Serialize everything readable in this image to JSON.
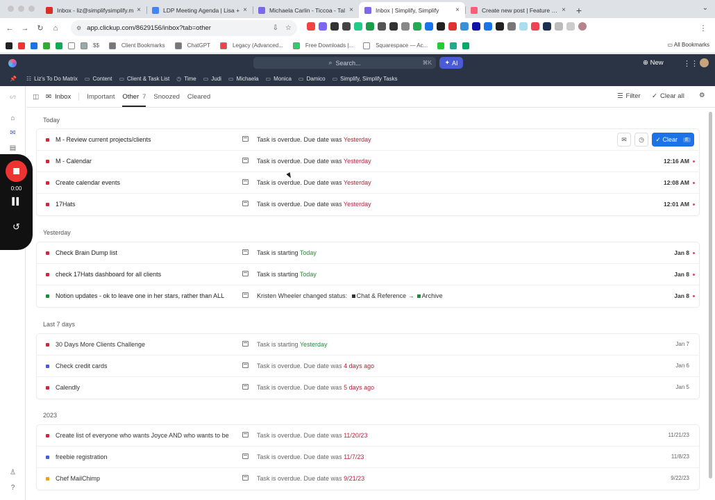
{
  "browser": {
    "tabs": [
      {
        "title": "Inbox - liz@simplifysimplify.m",
        "color": "#d93025",
        "active": false
      },
      {
        "title": "LDP Meeting Agenda | Lisa +",
        "color": "#4285f4",
        "active": false
      },
      {
        "title": "Michaela Carlin - Ticcoa - Tal",
        "color": "#7b68ee",
        "active": false
      },
      {
        "title": "Inbox | Simplify, Simplify",
        "color": "#7b68ee",
        "active": true
      },
      {
        "title": "Create new post | Feature Re",
        "color": "#ff5c7a",
        "active": false
      }
    ],
    "url": "app.clickup.com/8629156/inbox?tab=other",
    "bookmarks": [
      {
        "label": "$$",
        "color": "#9aa"
      },
      {
        "label": "Client Bookmarks",
        "color": "#777"
      },
      {
        "label": "ChatGPT",
        "color": "#777"
      },
      {
        "label": "Legacy (Advanced...",
        "color": "#e44"
      },
      {
        "label": "Free Downloads |...",
        "color": "#3c6"
      },
      {
        "label": "Squarespace — Ac...",
        "color": "#fff"
      }
    ],
    "all_bookmarks": "All Bookmarks"
  },
  "app": {
    "search_placeholder": "Search...",
    "search_shortcut": "⌘K",
    "ai_label": "AI",
    "new_label": "New",
    "favorites": [
      "Liz's To Do Matrix",
      "Content",
      "Client & Task List",
      "Time",
      "Judi",
      "Michaela",
      "Monica",
      "Damico",
      "Simplify, Simplify Tasks"
    ]
  },
  "recorder": {
    "time": "0:00"
  },
  "toolbar": {
    "inbox": "Inbox",
    "tabs": [
      {
        "label": "Important",
        "count": ""
      },
      {
        "label": "Other",
        "count": "7"
      },
      {
        "label": "Snoozed",
        "count": ""
      },
      {
        "label": "Cleared",
        "count": ""
      }
    ],
    "filter": "Filter",
    "clear_all": "Clear all"
  },
  "hover_actions": {
    "clear": "Clear",
    "clear_key": "E"
  },
  "sections": [
    {
      "title": "Today",
      "rows": [
        {
          "name": "M - Review current projects/clients",
          "pri": "#c62b3e",
          "msg": "Task is overdue. Due date was ",
          "hl": "Yesterday",
          "hl_type": "red",
          "date": "",
          "hover": true
        },
        {
          "name": "M - Calendar",
          "pri": "#c62b3e",
          "msg": "Task is overdue. Due date was ",
          "hl": "Yesterday",
          "hl_type": "red",
          "date": "12:16 AM"
        },
        {
          "name": "Create calendar events",
          "pri": "#c62b3e",
          "msg": "Task is overdue. Due date was ",
          "hl": "Yesterday",
          "hl_type": "red",
          "date": "12:08 AM"
        },
        {
          "name": "17Hats",
          "pri": "#c62b3e",
          "msg": "Task is overdue. Due date was ",
          "hl": "Yesterday",
          "hl_type": "red",
          "date": "12:01 AM"
        }
      ]
    },
    {
      "title": "Yesterday",
      "rows": [
        {
          "name": "Check Brain Dump list",
          "pri": "#c62b3e",
          "msg": "Task is starting ",
          "hl": "Today",
          "hl_type": "grn",
          "date": "Jan 8"
        },
        {
          "name": "check 17Hats dashboard for all clients",
          "pri": "#c62b3e",
          "msg": "Task is starting ",
          "hl": "Today",
          "hl_type": "grn",
          "date": "Jan 8"
        },
        {
          "name": "Notion updates - ok to leave one in her stars, rather than ALL",
          "pri": "#1f8a3a",
          "msg": "Kristen Wheeler changed status: ",
          "status_from": "Chat & Reference",
          "status_to": "Archive",
          "status_color": "#1f8a3a",
          "date": "Jan 8"
        }
      ]
    },
    {
      "title": "Last 7 days",
      "rows": [
        {
          "name": "30 Days More Clients Challenge",
          "pri": "#c62b3e",
          "msg": "Task is starting ",
          "hl": "Yesterday",
          "hl_type": "grn",
          "date": "Jan 7"
        },
        {
          "name": "Check credit cards",
          "pri": "#4a5bd6",
          "msg": "Task is overdue. Due date was ",
          "hl": "4 days ago",
          "hl_type": "red",
          "date": "Jan 6"
        },
        {
          "name": "Calendly",
          "pri": "#c62b3e",
          "msg": "Task is overdue. Due date was ",
          "hl": "5 days ago",
          "hl_type": "red",
          "date": "Jan 5"
        }
      ]
    },
    {
      "title": "2023",
      "rows": [
        {
          "name": "Create list of everyone who wants Joyce AND who wants to be",
          "pri": "#c62b3e",
          "msg": "Task is overdue. Due date was ",
          "hl": "11/20/23",
          "hl_type": "red",
          "date": "11/21/23"
        },
        {
          "name": "freebie registration",
          "pri": "#4a5bd6",
          "msg": "Task is overdue. Due date was ",
          "hl": "11/7/23",
          "hl_type": "red",
          "date": "11/8/23"
        },
        {
          "name": "Chef MailChimp",
          "pri": "#e8a317",
          "msg": "Task is overdue. Due date was ",
          "hl": "9/21/23",
          "hl_type": "red",
          "date": "9/22/23"
        }
      ]
    }
  ]
}
